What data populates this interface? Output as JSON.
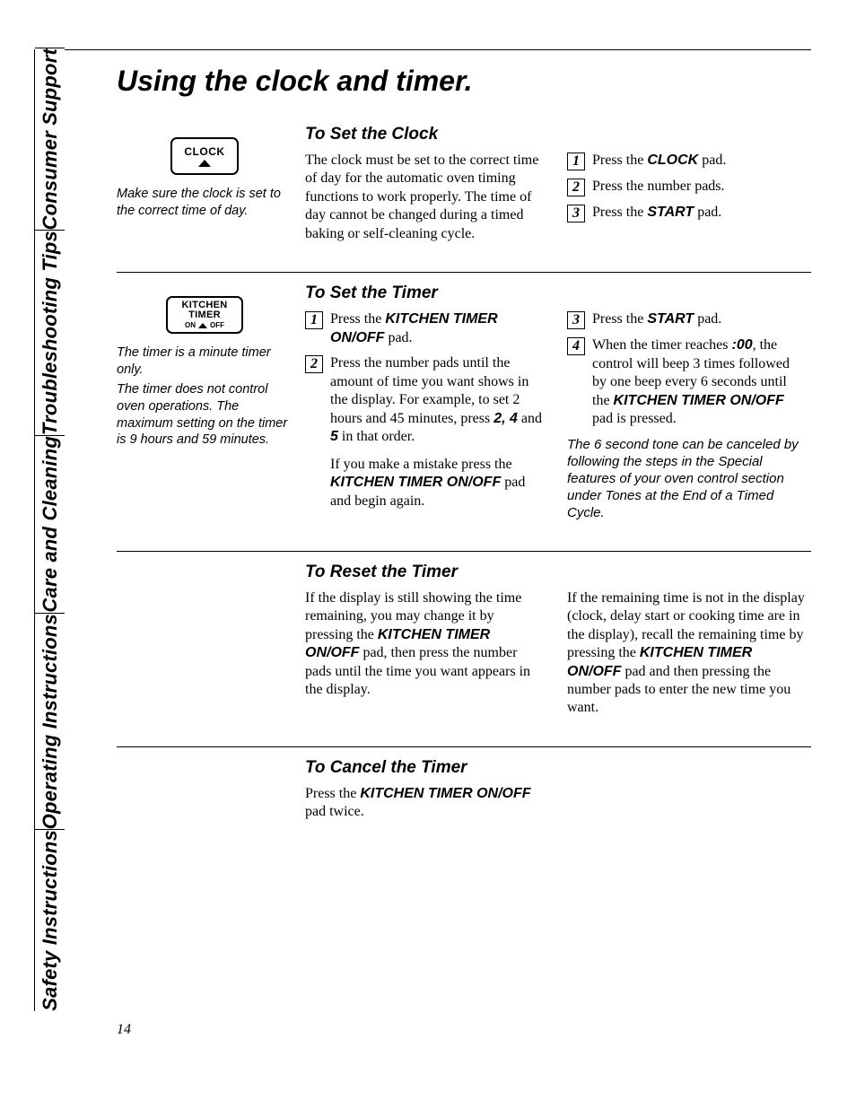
{
  "page_number": "14",
  "title": "Using the clock and timer.",
  "tabs": [
    "Safety Instructions",
    "Operating Instructions",
    "Care and Cleaning",
    "Troubleshooting Tips",
    "Consumer Support"
  ],
  "clock_btn": {
    "label": "CLOCK"
  },
  "kt_btn": {
    "line1": "KITCHEN",
    "line2": "TIMER",
    "on": "ON",
    "off": "OFF"
  },
  "sec1": {
    "heading": "To Set the Clock",
    "caption": "Make sure the clock is set to the correct time of day.",
    "intro": "The clock must be set to the correct time of day for the automatic oven timing functions to work properly. The time of day cannot be changed during a timed baking or self-cleaning cycle.",
    "steps": [
      {
        "pre": "Press the ",
        "kw": "CLOCK",
        "post": " pad."
      },
      {
        "pre": "Press the number pads.",
        "kw": "",
        "post": ""
      },
      {
        "pre": "Press the ",
        "kw": "START",
        "post": " pad."
      }
    ]
  },
  "sec2": {
    "heading": "To Set the Timer",
    "caption_p1": "The timer is a minute timer only.",
    "caption_p2": "The timer does not control oven operations. The maximum setting on the timer is 9 hours and 59 minutes.",
    "left_steps": {
      "s1": {
        "pre": "Press the ",
        "kw": "KITCHEN TIMER ON/OFF",
        "post": " pad."
      },
      "s2": {
        "pre": "Press the number pads until the amount of time you want shows in the display. For example, to set 2 hours and 45 minutes, press ",
        "kw1": "2, 4",
        "mid": " and ",
        "kw2": "5",
        "post": " in that order.",
        "extra_pre": "If you make a mistake press the ",
        "extra_kw": "KITCHEN TIMER ON/OFF",
        "extra_post": " pad and begin again."
      }
    },
    "right_steps": {
      "s3": {
        "pre": "Press the ",
        "kw": "START",
        "post": " pad."
      },
      "s4": {
        "pre": "When the timer reaches ",
        "kw1": ":00",
        "mid": ", the control will beep 3 times followed by one beep every 6 seconds until the ",
        "kw2": "KITCHEN TIMER ON/OFF",
        "post": " pad is pressed."
      }
    },
    "note": "The 6 second tone can be canceled by following the steps in the Special features of your oven control section under Tones at the End of a Timed Cycle."
  },
  "sec3": {
    "heading": "To Reset the Timer",
    "left": {
      "pre": "If the display is still showing the time remaining, you may change it by pressing the ",
      "kw": "KITCHEN TIMER ON/OFF",
      "post": " pad, then press the number pads until the time you want appears in the display."
    },
    "right": {
      "pre": "If the remaining time is not in the display (clock, delay start or cooking time are in the display), recall the remaining time by pressing the ",
      "kw": "KITCHEN TIMER ON/OFF",
      "post": " pad and then pressing the number pads to enter the new time you want."
    }
  },
  "sec4": {
    "heading": "To Cancel the Timer",
    "text_pre": "Press the ",
    "text_kw": "KITCHEN TIMER ON/OFF",
    "text_post": " pad twice."
  }
}
